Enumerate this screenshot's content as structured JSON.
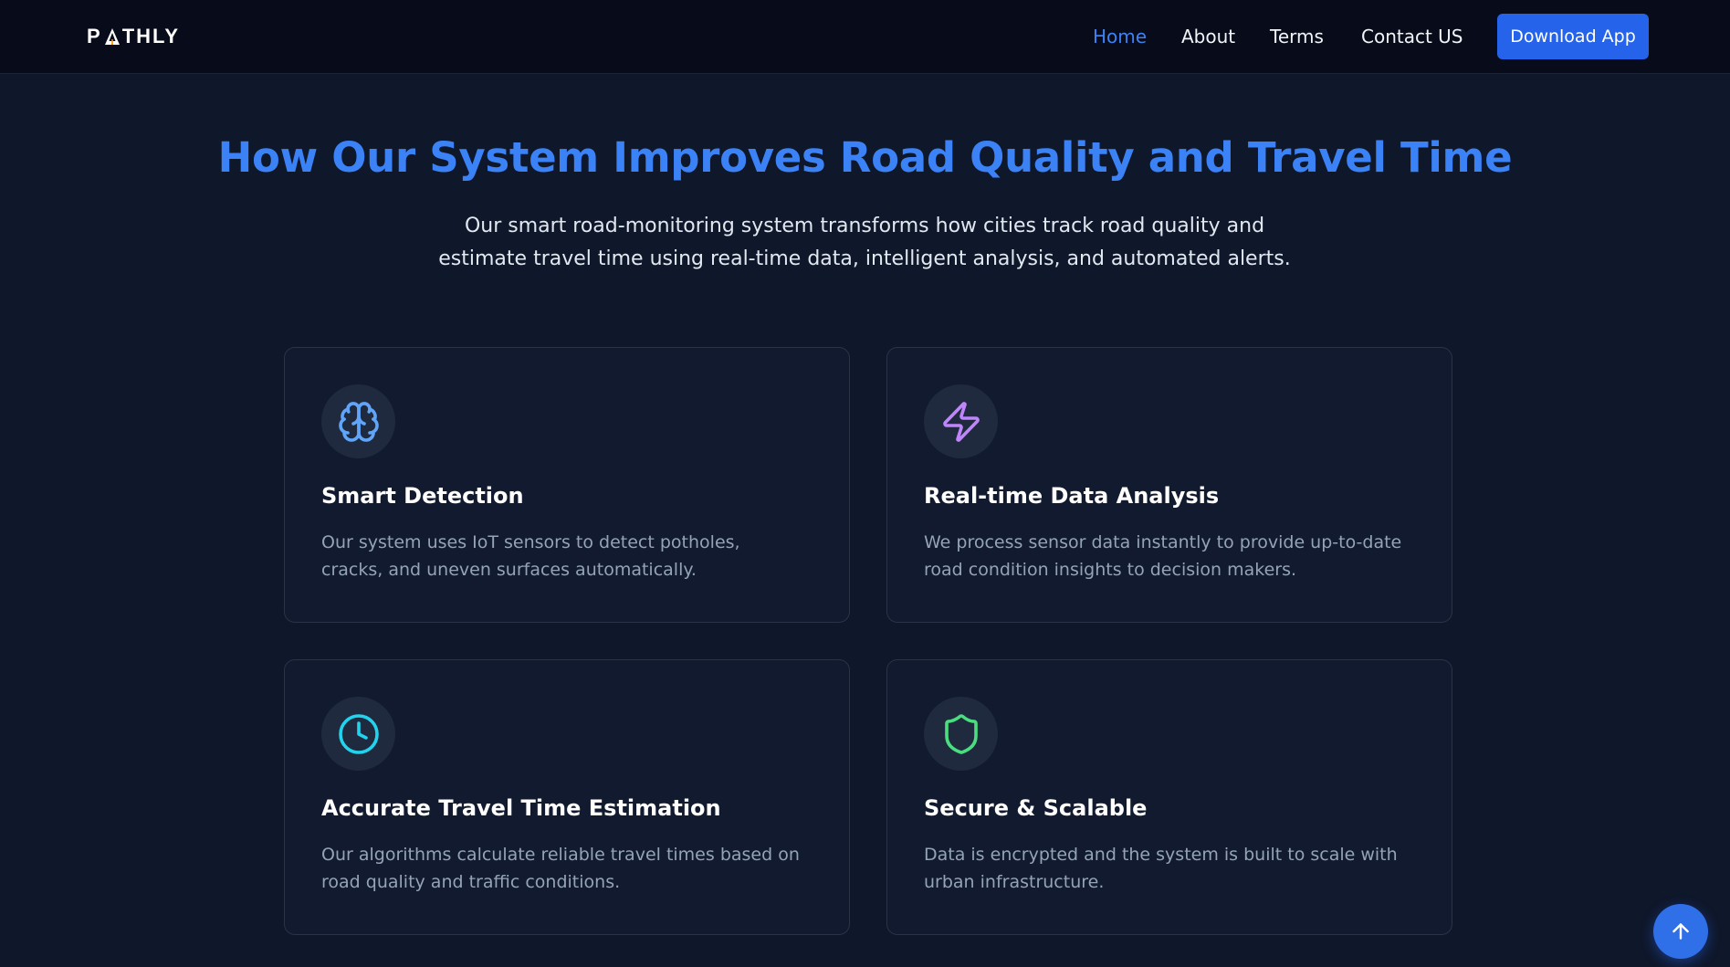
{
  "nav": {
    "logo_left": "P",
    "logo_right": "THLY",
    "links": [
      {
        "label": "Home",
        "active": true
      },
      {
        "label": "About",
        "active": false
      },
      {
        "label": "Terms",
        "active": false
      },
      {
        "label": "Contact US",
        "active": false
      }
    ],
    "download_label": "Download App"
  },
  "hero": {
    "title": "How Our System Improves Road Quality and Travel Time",
    "subtitle_line1": "Our smart road-monitoring system transforms how cities track road quality and",
    "subtitle_line2": "estimate travel time using real-time data, intelligent analysis, and automated alerts."
  },
  "features": [
    {
      "icon": "brain-icon",
      "color": "#60a5fa",
      "title": "Smart Detection",
      "desc_line1": "Our system uses IoT sensors to detect potholes,",
      "desc_line2": "cracks, and uneven surfaces automatically."
    },
    {
      "icon": "lightning-icon",
      "color": "#c084fc",
      "title": "Real-time Data Analysis",
      "desc_line1": "We process sensor data instantly to provide up-to-date",
      "desc_line2": "road condition insights to decision makers."
    },
    {
      "icon": "clock-icon",
      "color": "#22d3ee",
      "title": "Accurate Travel Time Estimation",
      "desc_line1": "Our algorithms calculate reliable travel times based on",
      "desc_line2": "road quality and traffic conditions."
    },
    {
      "icon": "shield-icon",
      "color": "#4ade80",
      "title": "Secure & Scalable",
      "desc_line1": "Data is encrypted and the system is built to scale with",
      "desc_line2": "urban infrastructure."
    }
  ],
  "colors": {
    "accent": "#3b82f6",
    "button": "#2563eb",
    "background": "#0f172a",
    "nav_background": "#070b1a"
  }
}
